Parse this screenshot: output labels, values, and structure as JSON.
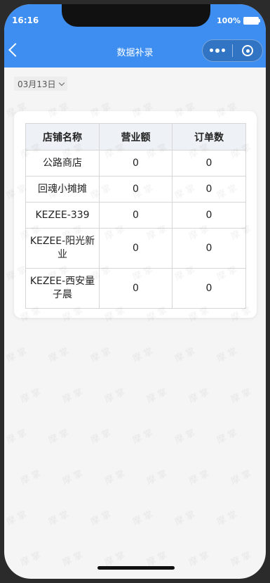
{
  "status_bar": {
    "time": "16:16",
    "battery": "100%"
  },
  "nav": {
    "title": "数据补录"
  },
  "filter": {
    "date": "03月13日"
  },
  "table": {
    "headers": [
      "店铺名称",
      "营业额",
      "订单数"
    ],
    "rows": [
      {
        "name": "公路商店",
        "revenue": "0",
        "orders": "0"
      },
      {
        "name": "回魂小摊摊",
        "revenue": "0",
        "orders": "0"
      },
      {
        "name": "KEZEE-339",
        "revenue": "0",
        "orders": "0"
      },
      {
        "name": "KEZEE-阳光新业",
        "revenue": "0",
        "orders": "0"
      },
      {
        "name": "KEZEE-西安量子晨",
        "revenue": "0",
        "orders": "0"
      }
    ]
  },
  "watermark": {
    "text": "摩 掌"
  },
  "colors": {
    "nav_bg": "#3d8ef0",
    "header_bg": "#eef1f5",
    "page_bg": "#f5f5f5"
  }
}
